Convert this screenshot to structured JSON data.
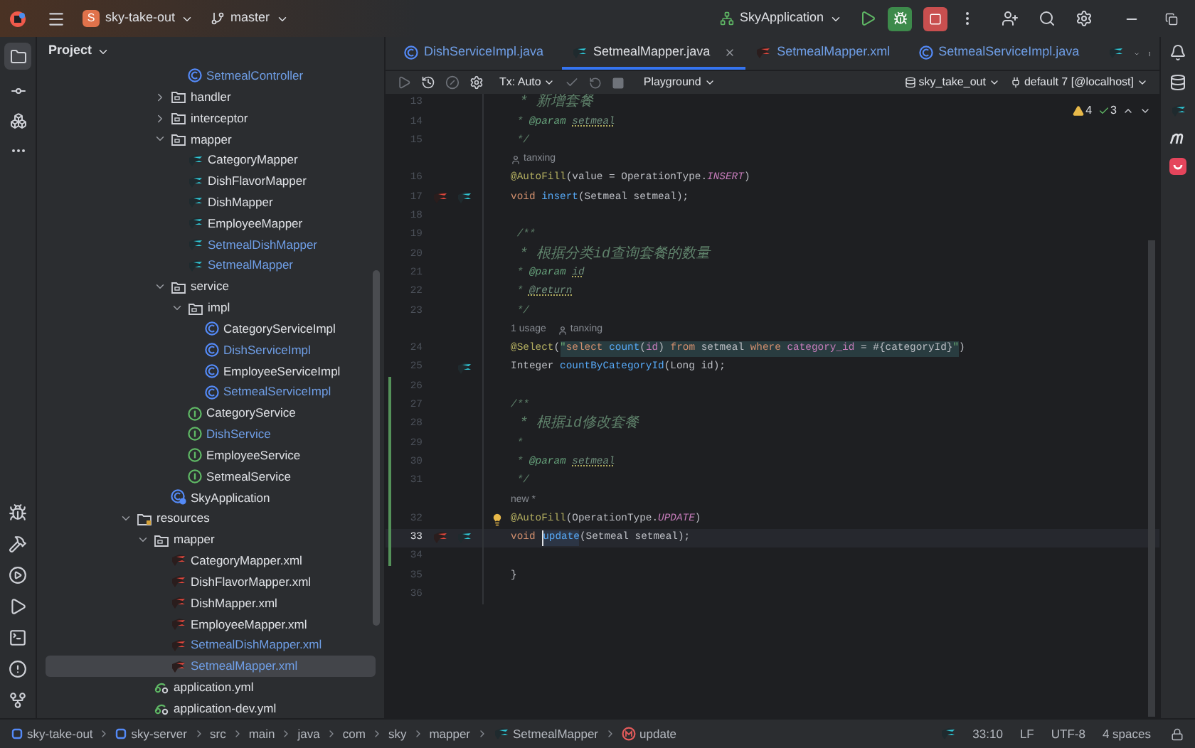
{
  "title_bar": {
    "project_badge": "S",
    "project": "sky-take-out",
    "branch": "master",
    "run_config": "SkyApplication"
  },
  "project_panel": {
    "title": "Project",
    "tree": [
      {
        "children": [
          {
            "children": [
              {
                "children": [
                  {
                    "label": "SetmealController",
                    "kind": "class",
                    "modified": true,
                    "selected": false
                  }
                ]
              },
              {
                "label": "handler",
                "kind": "folder",
                "expanded": false,
                "modified": false,
                "selected": false
              },
              {
                "label": "interceptor",
                "kind": "folder",
                "expanded": false,
                "modified": false,
                "selected": false
              },
              {
                "label": "mapper",
                "kind": "folder",
                "expanded": true,
                "modified": false,
                "selected": false,
                "children": [
                  {
                    "label": "CategoryMapper",
                    "kind": "mapper",
                    "modified": false,
                    "selected": false
                  },
                  {
                    "label": "DishFlavorMapper",
                    "kind": "mapper",
                    "modified": false,
                    "selected": false
                  },
                  {
                    "label": "DishMapper",
                    "kind": "mapper",
                    "modified": false,
                    "selected": false
                  },
                  {
                    "label": "EmployeeMapper",
                    "kind": "mapper",
                    "modified": false,
                    "selected": false
                  },
                  {
                    "label": "SetmealDishMapper",
                    "kind": "mapper",
                    "modified": true,
                    "selected": false
                  },
                  {
                    "label": "SetmealMapper",
                    "kind": "mapper",
                    "modified": true,
                    "selected": false
                  }
                ]
              },
              {
                "label": "service",
                "kind": "folder",
                "expanded": true,
                "modified": false,
                "selected": false,
                "children": [
                  {
                    "label": "impl",
                    "kind": "folder",
                    "expanded": true,
                    "modified": false,
                    "selected": false,
                    "children": [
                      {
                        "label": "CategoryServiceImpl",
                        "kind": "class",
                        "modified": false,
                        "selected": false
                      },
                      {
                        "label": "DishServiceImpl",
                        "kind": "class",
                        "modified": true,
                        "selected": false
                      },
                      {
                        "label": "EmployeeServiceImpl",
                        "kind": "class",
                        "modified": false,
                        "selected": false
                      },
                      {
                        "label": "SetmealServiceImpl",
                        "kind": "class",
                        "modified": true,
                        "selected": false
                      }
                    ]
                  },
                  {
                    "label": "CategoryService",
                    "kind": "interface",
                    "modified": false,
                    "selected": false
                  },
                  {
                    "label": "DishService",
                    "kind": "interface",
                    "modified": true,
                    "selected": false
                  },
                  {
                    "label": "EmployeeService",
                    "kind": "interface",
                    "modified": false,
                    "selected": false
                  },
                  {
                    "label": "SetmealService",
                    "kind": "interface",
                    "modified": false,
                    "selected": false
                  }
                ]
              },
              {
                "label": "SkyApplication",
                "kind": "app",
                "modified": false,
                "selected": false
              }
            ]
          }
        ]
      },
      {
        "label": "resources",
        "kind": "resources",
        "expanded": true,
        "modified": false,
        "selected": false,
        "children": [
          {
            "label": "mapper",
            "kind": "folder",
            "expanded": true,
            "modified": false,
            "selected": false,
            "children": [
              {
                "label": "CategoryMapper.xml",
                "kind": "xml",
                "modified": false,
                "selected": false
              },
              {
                "label": "DishFlavorMapper.xml",
                "kind": "xml",
                "modified": false,
                "selected": false
              },
              {
                "label": "DishMapper.xml",
                "kind": "xml",
                "modified": false,
                "selected": false
              },
              {
                "label": "EmployeeMapper.xml",
                "kind": "xml",
                "modified": false,
                "selected": false
              },
              {
                "label": "SetmealDishMapper.xml",
                "kind": "xml",
                "modified": true,
                "selected": false
              },
              {
                "label": "SetmealMapper.xml",
                "kind": "xml",
                "modified": true,
                "selected": true
              }
            ]
          },
          {
            "label": "application.yml",
            "kind": "yml",
            "modified": false,
            "selected": false
          },
          {
            "label": "application-dev.yml",
            "kind": "yml",
            "modified": false,
            "selected": false
          }
        ]
      }
    ]
  },
  "tabs": [
    {
      "label": "DishServiceImpl.java",
      "kind": "class",
      "modified": true,
      "selected": false
    },
    {
      "label": "SetmealMapper.java",
      "kind": "mapper",
      "modified": false,
      "selected": true
    },
    {
      "label": "SetmealMapper.xml",
      "kind": "xml",
      "modified": true,
      "selected": false
    },
    {
      "label": "SetmealServiceImpl.java",
      "kind": "class",
      "modified": true,
      "selected": false
    },
    {
      "kind": "mapper",
      "selected": false
    }
  ],
  "editor_toolbar": {
    "tx": "Tx: Auto",
    "playground": "Playground",
    "schema": "sky_take_out",
    "datasource": "default 7 [@localhost]"
  },
  "inspections": {
    "warnings": "4",
    "passed": "3"
  },
  "code": [
    {
      "kind": "code",
      "number": "13",
      "changed": false,
      "current": false,
      "segments": [
        {
          "text": " * 新增套餐",
          "kind": "comment"
        }
      ]
    },
    {
      "kind": "code",
      "number": "14",
      "changed": false,
      "current": false,
      "segments": [
        {
          "text": " * ",
          "kind": "comment"
        },
        {
          "text": "@param ",
          "kind": "doctag"
        },
        {
          "text": "setmeal",
          "kind": "docref"
        }
      ]
    },
    {
      "kind": "code",
      "number": "15",
      "changed": false,
      "current": false,
      "segments": [
        {
          "text": " */",
          "kind": "comment"
        }
      ]
    },
    {
      "kind": "hint",
      "changed": false,
      "segments": [
        {
          "text": "tanxing",
          "kind": "author"
        }
      ]
    },
    {
      "kind": "code",
      "number": "16",
      "changed": false,
      "current": false,
      "segments": [
        {
          "text": "@AutoFill",
          "kind": "annotation"
        },
        {
          "text": "(value = OperationType.",
          "kind": "plain"
        },
        {
          "text": "INSERT",
          "kind": "constant"
        },
        {
          "text": ")",
          "kind": "plain"
        }
      ]
    },
    {
      "kind": "code",
      "number": "17",
      "changed": false,
      "current": false,
      "xml_link": true,
      "mapper_link": true,
      "segments": [
        {
          "text": "void ",
          "kind": "keyword"
        },
        {
          "text": "insert",
          "kind": "method"
        },
        {
          "text": "(Setmeal setmeal);",
          "kind": "plain"
        }
      ]
    },
    {
      "kind": "code",
      "number": "18",
      "changed": false,
      "current": false
    },
    {
      "kind": "code",
      "number": "19",
      "changed": false,
      "current": false,
      "segments": [
        {
          "text": " /**",
          "kind": "comment"
        }
      ]
    },
    {
      "kind": "code",
      "number": "20",
      "changed": false,
      "current": false,
      "segments": [
        {
          "text": " * 根据分类id查询套餐的数量",
          "kind": "comment"
        }
      ]
    },
    {
      "kind": "code",
      "number": "21",
      "changed": false,
      "current": false,
      "segments": [
        {
          "text": " * ",
          "kind": "comment"
        },
        {
          "text": "@param ",
          "kind": "doctag"
        },
        {
          "text": "id",
          "kind": "docref"
        }
      ]
    },
    {
      "kind": "code",
      "number": "22",
      "changed": false,
      "current": false,
      "segments": [
        {
          "text": " * ",
          "kind": "comment"
        },
        {
          "text": "@return",
          "kind": "docref"
        }
      ]
    },
    {
      "kind": "code",
      "number": "23",
      "changed": false,
      "current": false,
      "segments": [
        {
          "text": " */",
          "kind": "comment"
        }
      ]
    },
    {
      "kind": "hint",
      "changed": false,
      "segments": [
        {
          "text": "1 usage",
          "kind": "usage"
        },
        {
          "text": "tanxing",
          "kind": "author"
        }
      ]
    },
    {
      "kind": "code",
      "number": "24",
      "changed": false,
      "current": false,
      "segments": [
        {
          "text": "@Select",
          "kind": "annotation"
        },
        {
          "text": "(",
          "kind": "plain"
        },
        {
          "text": "\"",
          "kind": "string"
        },
        {
          "text": "select ",
          "kind": "sqlkw"
        },
        {
          "text": "count",
          "kind": "sqlfn"
        },
        {
          "text": "(",
          "kind": "sql"
        },
        {
          "text": "id",
          "kind": "sqlcol"
        },
        {
          "text": ") ",
          "kind": "sql"
        },
        {
          "text": "from",
          "kind": "sqlkw"
        },
        {
          "text": " setmeal ",
          "kind": "sql"
        },
        {
          "text": "where ",
          "kind": "sqlkw"
        },
        {
          "text": "category_id",
          "kind": "sqlcol"
        },
        {
          "text": " = #{categoryId}",
          "kind": "sql"
        },
        {
          "text": "\"",
          "kind": "string"
        },
        {
          "text": ")",
          "kind": "plain"
        }
      ]
    },
    {
      "kind": "code",
      "number": "25",
      "changed": false,
      "current": false,
      "mapper_link": true,
      "segments": [
        {
          "text": "Integer ",
          "kind": "plain"
        },
        {
          "text": "countByCategoryId",
          "kind": "method"
        },
        {
          "text": "(Long id);",
          "kind": "plain"
        }
      ]
    },
    {
      "kind": "code",
      "number": "26",
      "changed": true,
      "current": false
    },
    {
      "kind": "code",
      "number": "27",
      "changed": true,
      "current": false,
      "segments": [
        {
          "text": "/**",
          "kind": "comment"
        }
      ]
    },
    {
      "kind": "code",
      "number": "28",
      "changed": true,
      "current": false,
      "segments": [
        {
          "text": " * 根据id修改套餐",
          "kind": "comment"
        }
      ]
    },
    {
      "kind": "code",
      "number": "29",
      "changed": true,
      "current": false,
      "segments": [
        {
          "text": " *",
          "kind": "comment"
        }
      ]
    },
    {
      "kind": "code",
      "number": "30",
      "changed": true,
      "current": false,
      "segments": [
        {
          "text": " * ",
          "kind": "comment"
        },
        {
          "text": "@param ",
          "kind": "doctag"
        },
        {
          "text": "setmeal",
          "kind": "docref"
        }
      ]
    },
    {
      "kind": "code",
      "number": "31",
      "changed": true,
      "current": false,
      "segments": [
        {
          "text": " */",
          "kind": "comment"
        }
      ]
    },
    {
      "kind": "hint",
      "changed": true,
      "segments": [
        {
          "text": "new *",
          "kind": "vcs"
        }
      ]
    },
    {
      "kind": "code",
      "number": "32",
      "changed": true,
      "current": false,
      "bulb": true,
      "segments": [
        {
          "text": "@AutoFill",
          "kind": "annotation"
        },
        {
          "text": "(OperationType.",
          "kind": "plain"
        },
        {
          "text": "UPDATE",
          "kind": "constant"
        },
        {
          "text": ")",
          "kind": "plain"
        }
      ]
    },
    {
      "kind": "code",
      "number": "33",
      "changed": true,
      "current": true,
      "xml_link": true,
      "mapper_link": true,
      "segments": [
        {
          "text": "void ",
          "kind": "keyword"
        },
        {
          "text": "update",
          "kind": "caret-method"
        },
        {
          "text": "(Setmeal setmeal);",
          "kind": "plain"
        }
      ]
    },
    {
      "kind": "code",
      "number": "34",
      "changed": true,
      "current": false
    },
    {
      "kind": "code",
      "number": "35",
      "changed": false,
      "current": false,
      "segments": [
        {
          "text": "}",
          "kind": "plain"
        }
      ]
    },
    {
      "kind": "code",
      "number": "36",
      "changed": false,
      "current": false
    }
  ],
  "status_bar": {
    "breadcrumbs": [
      {
        "label": "sky-take-out",
        "kind": "module"
      },
      {
        "label": "sky-server",
        "kind": "module"
      },
      {
        "label": "src",
        "kind": "folder"
      },
      {
        "label": "main",
        "kind": "folder"
      },
      {
        "label": "java",
        "kind": "folder"
      },
      {
        "label": "com",
        "kind": "folder"
      },
      {
        "label": "sky",
        "kind": "folder"
      },
      {
        "label": "mapper",
        "kind": "folder"
      },
      {
        "label": "SetmealMapper",
        "kind": "mapper"
      },
      {
        "label": "update",
        "kind": "method"
      }
    ],
    "position": "33:10",
    "line_ending": "LF",
    "encoding": "UTF-8",
    "indent": "4 spaces"
  }
}
